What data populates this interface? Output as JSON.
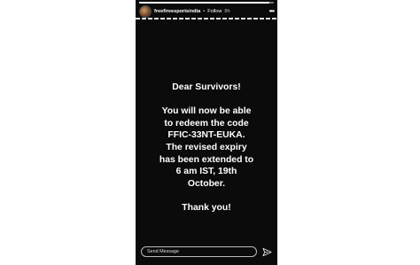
{
  "story": {
    "progress_fraction": 0.97,
    "header": {
      "username": "freefireesportsindia",
      "separator": "•",
      "follow_label": "Follow",
      "time": "8h",
      "more_icon": "more-dots-icon"
    },
    "message": {
      "lines_1": [
        "Dear Survivors!"
      ],
      "lines_2": [
        "You will now be able",
        "to redeem the code",
        "FFIC-33NT-EUKA.",
        "The revised expiry",
        "has been extended to",
        "6 am IST, 19th",
        "October."
      ],
      "lines_3": [
        "Thank you!"
      ]
    },
    "footer": {
      "send_placeholder": "Send Message",
      "send_icon": "paper-plane-icon"
    }
  },
  "colors": {
    "story_bg": "#0b0b0b",
    "text": "#ffffff",
    "page_bg": "#ffffff"
  }
}
